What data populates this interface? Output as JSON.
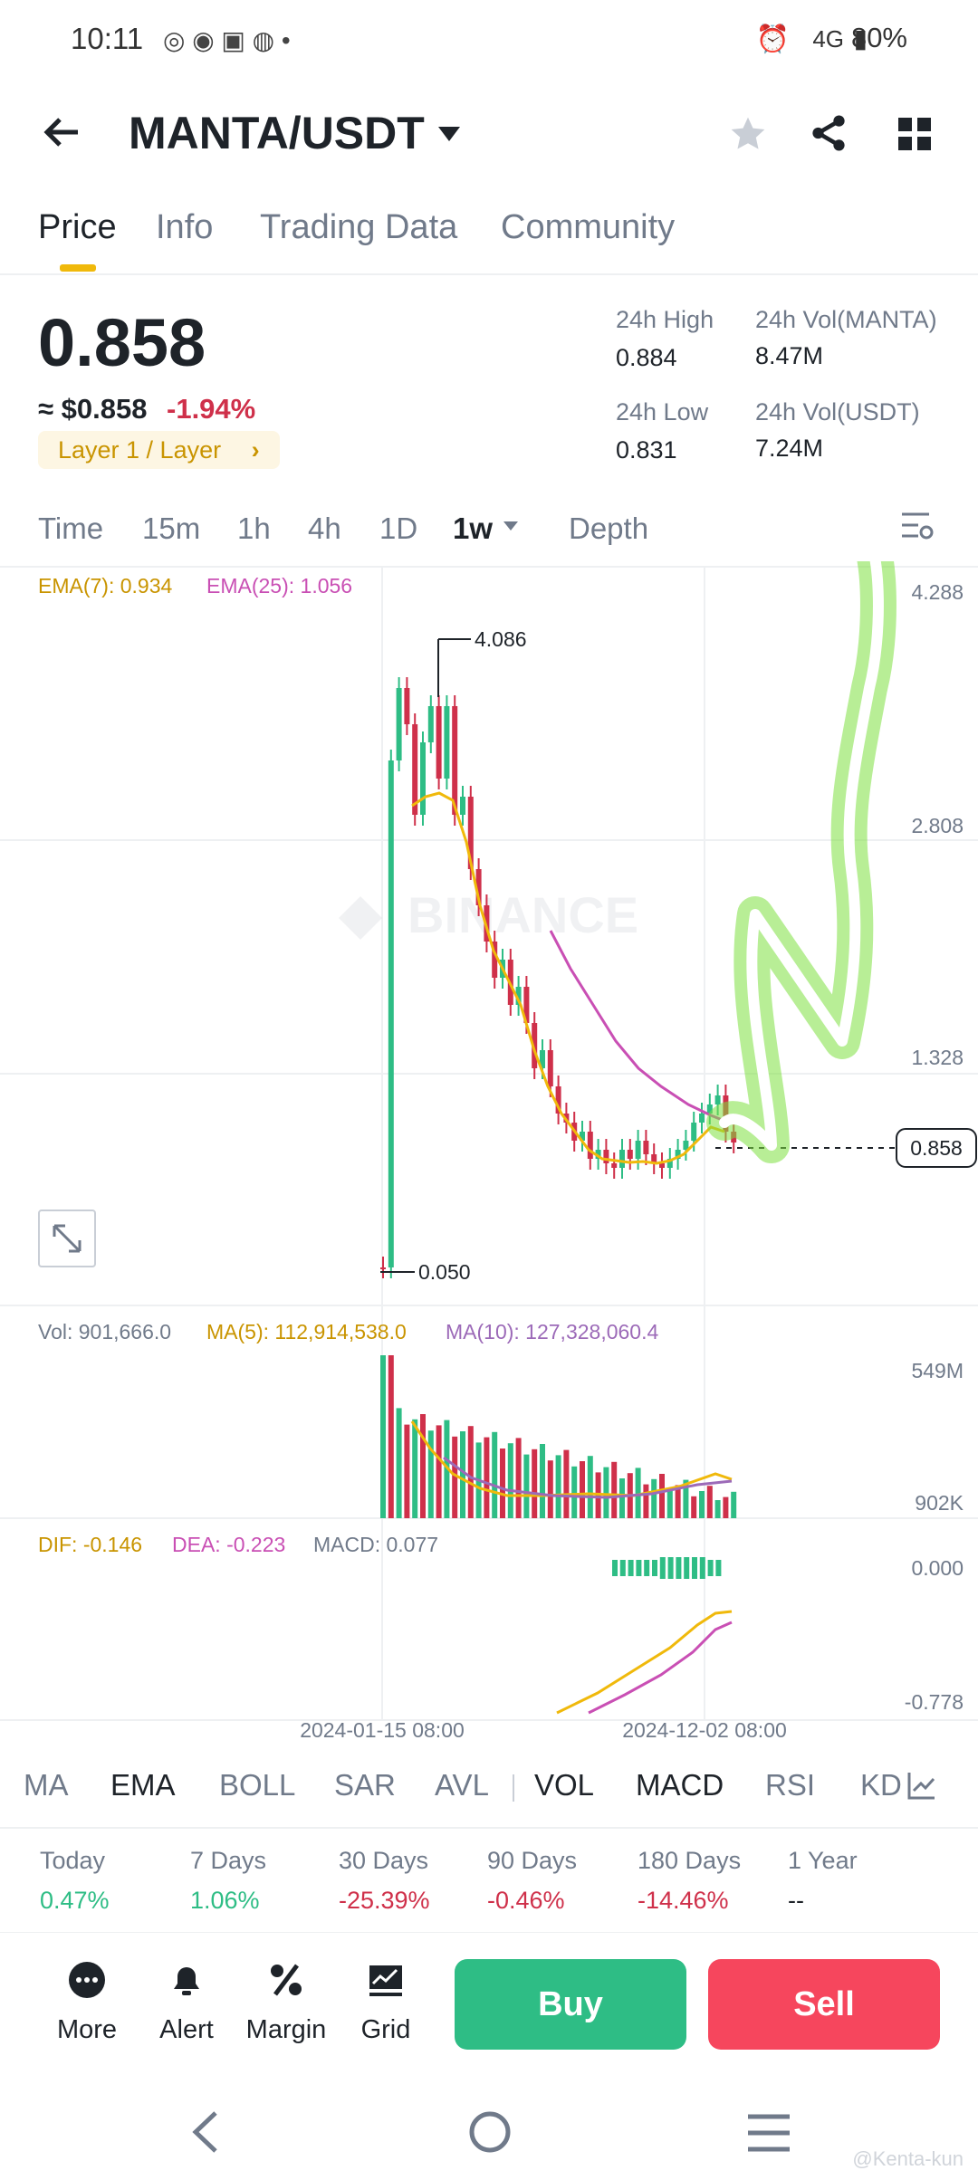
{
  "status_bar": {
    "time": "10:11",
    "network": "4G",
    "battery": "80%"
  },
  "header": {
    "pair": "MANTA/USDT"
  },
  "tabs": [
    {
      "label": "Price"
    },
    {
      "label": "Info"
    },
    {
      "label": "Trading Data"
    },
    {
      "label": "Community"
    }
  ],
  "price": {
    "last": "0.858",
    "usd": "≈ $0.858",
    "change": "-1.94%",
    "tag": "Layer 1 / Layer",
    "high_label": "24h High",
    "high": "0.884",
    "low_label": "24h Low",
    "low": "0.831",
    "vol_base_label": "24h Vol(MANTA)",
    "vol_base": "8.47M",
    "vol_quote_label": "24h Vol(USDT)",
    "vol_quote": "7.24M"
  },
  "intervals": [
    "Time",
    "15m",
    "1h",
    "4h",
    "1D",
    "1w",
    "Depth"
  ],
  "chart": {
    "ema7": "EMA(7): 0.934",
    "ema25": "EMA(25): 1.056",
    "y_ticks": [
      "4.288",
      "2.808",
      "1.328"
    ],
    "high_mark": "4.086",
    "low_mark": "0.050",
    "current": "0.858",
    "watermark": "BINANCE",
    "vol": "Vol: 901,666.0",
    "ma5": "MA(5): 112,914,538.0",
    "ma10": "MA(10): 127,328,060.4",
    "vol_ticks": [
      "549M",
      "902K"
    ],
    "dif": "DIF: -0.146",
    "dea": "DEA: -0.223",
    "macd": "MACD: 0.077",
    "macd_ticks": [
      "0.000",
      "-0.778"
    ],
    "x_labels": [
      "2024-01-15 08:00",
      "2024-12-02 08:00"
    ],
    "colors": {
      "up": "#2ebd85",
      "down": "#cf304a",
      "ema7": "#f0b90b",
      "ema25": "#c94fb4"
    }
  },
  "indicator_tabs": [
    "MA",
    "EMA",
    "BOLL",
    "SAR",
    "AVL",
    "VOL",
    "MACD",
    "RSI",
    "KD"
  ],
  "performance": [
    {
      "label": "Today",
      "value": "0.47%"
    },
    {
      "label": "7 Days",
      "value": "1.06%"
    },
    {
      "label": "30 Days",
      "value": "-25.39%"
    },
    {
      "label": "90 Days",
      "value": "-0.46%"
    },
    {
      "label": "180 Days",
      "value": "-14.46%"
    },
    {
      "label": "1 Year",
      "value": "--"
    }
  ],
  "bottom_bar": {
    "more": "More",
    "alert": "Alert",
    "margin": "Margin",
    "grid": "Grid",
    "buy": "Buy",
    "sell": "Sell"
  },
  "watermark_credit": "@Kenta-kun"
}
